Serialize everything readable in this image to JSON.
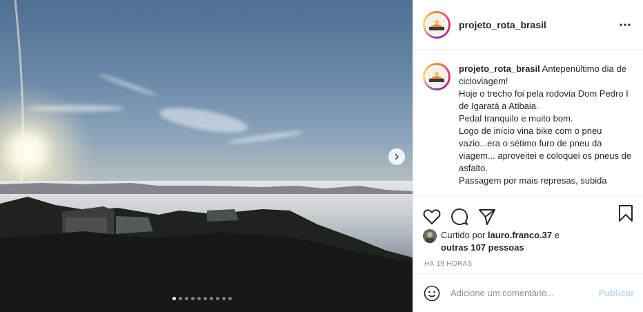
{
  "post": {
    "author": "projeto_rota_brasil",
    "carousel": {
      "slide_count": 10,
      "active_index": 0
    }
  },
  "header": {
    "username": "projeto_rota_brasil",
    "more_icon": "more-horizontal-icon"
  },
  "caption": {
    "username": "projeto_rota_brasil",
    "lines": [
      "Antepenúltimo dia de cicloviagem!",
      "Hoje o trecho foi pela rodovia Dom Pedro I de Igaratá a Atibaia.",
      "Pedal tranquilo e muito bom.",
      "Logo de início vina bike com o pneu vazio...era o sétimo furo de pneu da viagem... aproveitei e coloquei os pneus de asfalto.",
      "Passagem por mais represas, subida"
    ]
  },
  "actions": {
    "like_icon": "heart-icon",
    "comment_icon": "comment-icon",
    "share_icon": "share-icon",
    "save_icon": "bookmark-icon"
  },
  "likes": {
    "prefix": "Curtido por ",
    "user": "lauro.franco.37",
    "connector": " e",
    "others": "outras 107 pessoas"
  },
  "timestamp": "HÁ 19 HORAS",
  "comment": {
    "placeholder": "Adicione um comentário...",
    "publish_label": "Publicar",
    "emoji_icon": "emoji-icon"
  },
  "colors": {
    "text": "#262626",
    "muted": "#8e8e8e",
    "publish_disabled": "#b3dbff",
    "divider": "#efefef"
  }
}
